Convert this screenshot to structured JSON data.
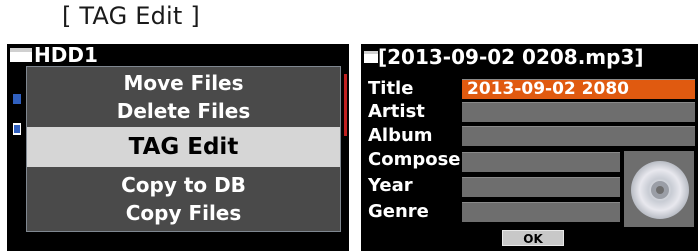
{
  "caption": "[ TAG Edit ]",
  "left_panel": {
    "header_title": "HDD1",
    "menu": [
      {
        "label": "Move Files"
      },
      {
        "label": "Delete Files"
      },
      {
        "label": "TAG Edit",
        "selected": true
      },
      {
        "label": "Copy to DB"
      },
      {
        "label": "Copy Files"
      }
    ]
  },
  "right_panel": {
    "header_title": "[2013-09-02 0208.mp3]",
    "fields": [
      {
        "label": "Title",
        "value": "2013-09-02 2080"
      },
      {
        "label": "Artist",
        "value": ""
      },
      {
        "label": "Album",
        "value": ""
      },
      {
        "label": "Composer",
        "value": ""
      },
      {
        "label": "Year",
        "value": ""
      },
      {
        "label": "Genre",
        "value": ""
      }
    ],
    "ok_label": "OK"
  },
  "colors": {
    "highlight": "#e05a10",
    "menu_background": "#4a4a4a",
    "selected_item": "#d6d6d6"
  },
  "icons": [
    "folder-icon",
    "cd-disc-icon"
  ]
}
